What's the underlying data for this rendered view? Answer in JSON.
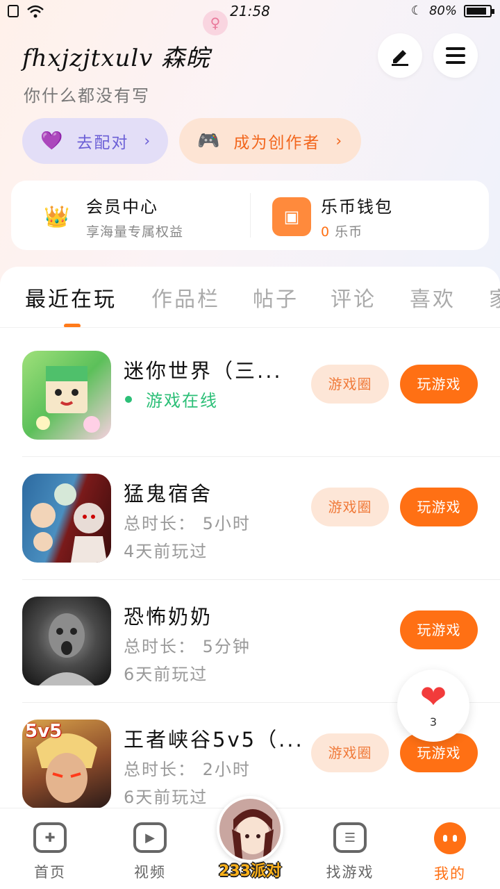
{
  "status_bar": {
    "time": "21:58",
    "battery": "80%",
    "battery_level": 0.8
  },
  "profile": {
    "username": "fhxjzjtxulv 森皖",
    "bio": "你什么都没有写",
    "edit_icon": "pen-icon",
    "menu_icon": "menu-icon"
  },
  "actions": {
    "match_label": "去配对",
    "creator_label": "成为创作者"
  },
  "vip": {
    "title": "会员中心",
    "subtitle": "享海量专属权益",
    "wallet_title": "乐币钱包",
    "wallet_amount": "0",
    "wallet_unit": "乐币"
  },
  "tabs": [
    {
      "label": "最近在玩",
      "active": true
    },
    {
      "label": "作品栏"
    },
    {
      "label": "帖子"
    },
    {
      "label": "评论"
    },
    {
      "label": "喜欢"
    },
    {
      "label": "家"
    }
  ],
  "games": [
    {
      "name": "迷你世界（三...",
      "status": "游戏在线",
      "circle_label": "游戏圈",
      "play_label": "玩游戏"
    },
    {
      "name": "猛鬼宿舍",
      "duration": "总时长： 5小时",
      "last_played": "4天前玩过",
      "circle_label": "游戏圈",
      "play_label": "玩游戏"
    },
    {
      "name": "恐怖奶奶",
      "duration": "总时长： 5分钟",
      "last_played": "6天前玩过",
      "play_label": "玩游戏"
    },
    {
      "name": "王者峡谷5v5（...",
      "duration": "总时长： 2小时",
      "last_played": "6天前玩过",
      "circle_label": "游戏圈",
      "play_label": "玩游戏"
    }
  ],
  "game4_badge": "5v5",
  "float_like": {
    "count": "3"
  },
  "nav": {
    "home": "首页",
    "video": "视频",
    "party": "233派对",
    "find": "找游戏",
    "me": "我的"
  },
  "colors": {
    "accent": "#ff7014",
    "online": "#2cbf77",
    "match": "#6b5fd6"
  }
}
